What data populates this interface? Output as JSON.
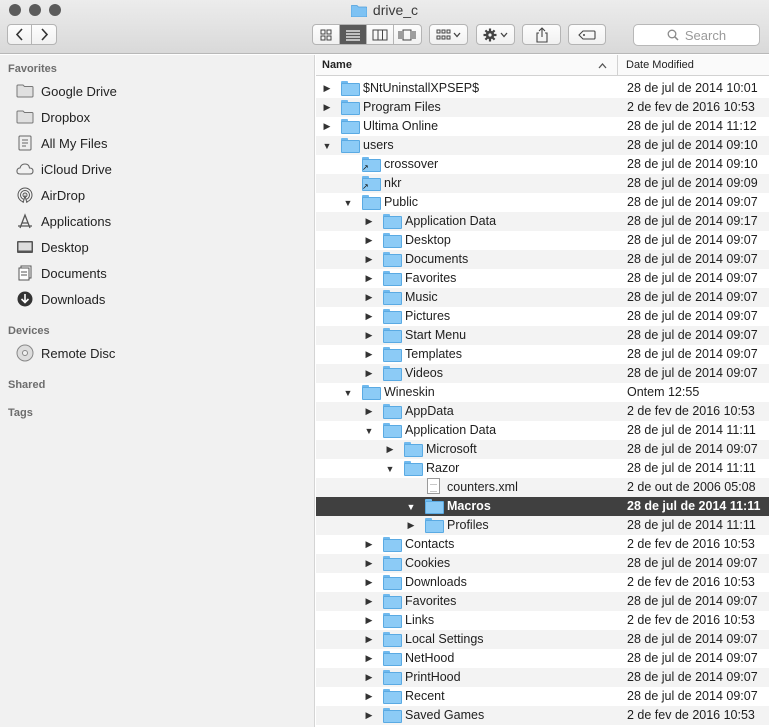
{
  "window": {
    "title": "drive_c",
    "search_placeholder": "Search"
  },
  "toolbar": {
    "back_glyph": "‹",
    "forward_glyph": "›",
    "view_icons": [
      "icon-view-icon",
      "list-view-icon",
      "column-view-icon",
      "cover-flow-icon"
    ],
    "active_view": "list"
  },
  "sidebar": {
    "sections": [
      {
        "title": "Favorites",
        "items": [
          {
            "label": "Google Drive",
            "icon": "folder-icon"
          },
          {
            "label": "Dropbox",
            "icon": "folder-icon"
          },
          {
            "label": "All My Files",
            "icon": "files-icon"
          },
          {
            "label": "iCloud Drive",
            "icon": "cloud-icon"
          },
          {
            "label": "AirDrop",
            "icon": "airdrop-icon"
          },
          {
            "label": "Applications",
            "icon": "applications-icon"
          },
          {
            "label": "Desktop",
            "icon": "desktop-icon"
          },
          {
            "label": "Documents",
            "icon": "documents-icon"
          },
          {
            "label": "Downloads",
            "icon": "downloads-icon"
          }
        ]
      },
      {
        "title": "Devices",
        "items": [
          {
            "label": "Remote Disc",
            "icon": "disc-icon"
          }
        ]
      },
      {
        "title": "Shared",
        "items": []
      },
      {
        "title": "Tags",
        "items": []
      }
    ]
  },
  "columns": {
    "name": "Name",
    "date": "Date Modified"
  },
  "files": [
    {
      "name": "$NtUninstallXPSEP$",
      "date": "28 de jul de 2014 10:01",
      "depth": 0,
      "expander": "collapsed",
      "kind": "folder"
    },
    {
      "name": "Program Files",
      "date": "2 de fev de 2016 10:53",
      "depth": 0,
      "expander": "collapsed",
      "kind": "folder"
    },
    {
      "name": "Ultima Online",
      "date": "28 de jul de 2014 11:12",
      "depth": 0,
      "expander": "collapsed",
      "kind": "folder"
    },
    {
      "name": "users",
      "date": "28 de jul de 2014 09:10",
      "depth": 0,
      "expander": "expanded",
      "kind": "folder"
    },
    {
      "name": "crossover",
      "date": "28 de jul de 2014 09:10",
      "depth": 1,
      "expander": "none",
      "kind": "alias"
    },
    {
      "name": "nkr",
      "date": "28 de jul de 2014 09:09",
      "depth": 1,
      "expander": "none",
      "kind": "alias"
    },
    {
      "name": "Public",
      "date": "28 de jul de 2014 09:07",
      "depth": 1,
      "expander": "expanded",
      "kind": "folder"
    },
    {
      "name": "Application Data",
      "date": "28 de jul de 2014 09:17",
      "depth": 2,
      "expander": "collapsed",
      "kind": "folder"
    },
    {
      "name": "Desktop",
      "date": "28 de jul de 2014 09:07",
      "depth": 2,
      "expander": "collapsed",
      "kind": "folder"
    },
    {
      "name": "Documents",
      "date": "28 de jul de 2014 09:07",
      "depth": 2,
      "expander": "collapsed",
      "kind": "folder"
    },
    {
      "name": "Favorites",
      "date": "28 de jul de 2014 09:07",
      "depth": 2,
      "expander": "collapsed",
      "kind": "folder"
    },
    {
      "name": "Music",
      "date": "28 de jul de 2014 09:07",
      "depth": 2,
      "expander": "collapsed",
      "kind": "folder"
    },
    {
      "name": "Pictures",
      "date": "28 de jul de 2014 09:07",
      "depth": 2,
      "expander": "collapsed",
      "kind": "folder"
    },
    {
      "name": "Start Menu",
      "date": "28 de jul de 2014 09:07",
      "depth": 2,
      "expander": "collapsed",
      "kind": "folder"
    },
    {
      "name": "Templates",
      "date": "28 de jul de 2014 09:07",
      "depth": 2,
      "expander": "collapsed",
      "kind": "folder"
    },
    {
      "name": "Videos",
      "date": "28 de jul de 2014 09:07",
      "depth": 2,
      "expander": "collapsed",
      "kind": "folder"
    },
    {
      "name": "Wineskin",
      "date": "Ontem 12:55",
      "depth": 1,
      "expander": "expanded",
      "kind": "folder"
    },
    {
      "name": "AppData",
      "date": "2 de fev de 2016 10:53",
      "depth": 2,
      "expander": "collapsed",
      "kind": "folder"
    },
    {
      "name": "Application Data",
      "date": "28 de jul de 2014 11:11",
      "depth": 2,
      "expander": "expanded",
      "kind": "folder"
    },
    {
      "name": "Microsoft",
      "date": "28 de jul de 2014 09:07",
      "depth": 3,
      "expander": "collapsed",
      "kind": "folder"
    },
    {
      "name": "Razor",
      "date": "28 de jul de 2014 11:11",
      "depth": 3,
      "expander": "expanded",
      "kind": "folder"
    },
    {
      "name": "counters.xml",
      "date": "2 de out de 2006 05:08",
      "depth": 4,
      "expander": "none",
      "kind": "document"
    },
    {
      "name": "Macros",
      "date": "28 de jul de 2014 11:11",
      "depth": 4,
      "expander": "expanded",
      "kind": "folder",
      "selected": true
    },
    {
      "name": "Profiles",
      "date": "28 de jul de 2014 11:11",
      "depth": 4,
      "expander": "collapsed",
      "kind": "folder"
    },
    {
      "name": "Contacts",
      "date": "2 de fev de 2016 10:53",
      "depth": 2,
      "expander": "collapsed",
      "kind": "folder"
    },
    {
      "name": "Cookies",
      "date": "28 de jul de 2014 09:07",
      "depth": 2,
      "expander": "collapsed",
      "kind": "folder"
    },
    {
      "name": "Downloads",
      "date": "2 de fev de 2016 10:53",
      "depth": 2,
      "expander": "collapsed",
      "kind": "folder"
    },
    {
      "name": "Favorites",
      "date": "28 de jul de 2014 09:07",
      "depth": 2,
      "expander": "collapsed",
      "kind": "folder"
    },
    {
      "name": "Links",
      "date": "2 de fev de 2016 10:53",
      "depth": 2,
      "expander": "collapsed",
      "kind": "folder"
    },
    {
      "name": "Local Settings",
      "date": "28 de jul de 2014 09:07",
      "depth": 2,
      "expander": "collapsed",
      "kind": "folder"
    },
    {
      "name": "NetHood",
      "date": "28 de jul de 2014 09:07",
      "depth": 2,
      "expander": "collapsed",
      "kind": "folder"
    },
    {
      "name": "PrintHood",
      "date": "28 de jul de 2014 09:07",
      "depth": 2,
      "expander": "collapsed",
      "kind": "folder"
    },
    {
      "name": "Recent",
      "date": "28 de jul de 2014 09:07",
      "depth": 2,
      "expander": "collapsed",
      "kind": "folder"
    },
    {
      "name": "Saved Games",
      "date": "2 de fev de 2016 10:53",
      "depth": 2,
      "expander": "collapsed",
      "kind": "folder"
    }
  ],
  "colors": {
    "selection": "#404040",
    "folder": "#8ccbf6",
    "sidebar_bg": "#f1f1f1"
  }
}
